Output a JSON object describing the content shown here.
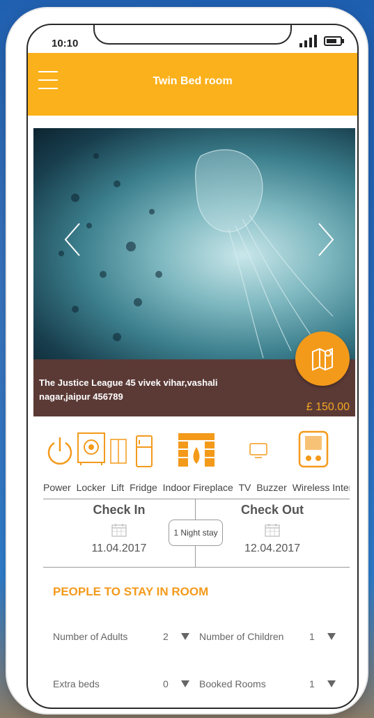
{
  "status_bar": {
    "time": "10:10"
  },
  "header": {
    "title": "Twin Bed room"
  },
  "property": {
    "address_line1": "The Justice League 45 vivek vihar,vashali",
    "address_line2": "nagar,jaipur 456789",
    "price": "£ 150.00"
  },
  "amenities": [
    "Power",
    "Locker",
    "Lift",
    "Fridge",
    "Indoor Fireplace",
    "TV",
    "Buzzer",
    "Wireless Inter"
  ],
  "booking": {
    "check_in_label": "Check In",
    "check_in_date": "11.04.2017",
    "check_out_label": "Check Out",
    "check_out_date": "12.04.2017",
    "stay_length": "1 Night stay"
  },
  "people": {
    "section_title": "PEOPLE TO STAY IN ROOM",
    "adults_label": "Number of Adults",
    "adults_value": "2",
    "children_label": "Number of Children",
    "children_value": "1",
    "extra_beds_label": "Extra beds",
    "extra_beds_value": "0",
    "booked_rooms_label": "Booked Rooms",
    "booked_rooms_value": "1"
  },
  "colors": {
    "accent": "#fbb11b",
    "orange": "#f39a1b",
    "info_bar": "#5b3a36"
  },
  "icons": [
    "menu-icon",
    "chevron-left-icon",
    "chevron-right-icon",
    "map-icon",
    "power-icon",
    "locker-icon",
    "lift-icon",
    "fridge-icon",
    "fireplace-icon",
    "tv-icon",
    "buzzer-icon",
    "calendar-icon",
    "dropdown-arrow-icon"
  ]
}
